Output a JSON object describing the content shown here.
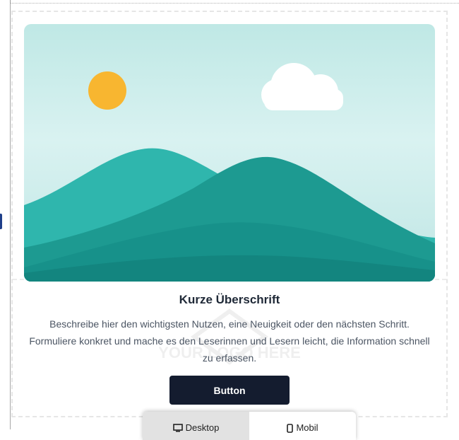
{
  "card": {
    "heading": "Kurze Überschrift",
    "description": "Beschreibe hier den wichtigsten Nutzen, eine Neuigkeit oder den nächsten Schritt. Formuliere konkret und mache es den Leserinnen und Lesern leicht, die Information schnell zu erfassen.",
    "button_label": "Button"
  },
  "view_toggle": {
    "options": [
      {
        "label": "Desktop",
        "icon": "monitor-icon",
        "active": true
      },
      {
        "label": "Mobil",
        "icon": "phone-icon",
        "active": false
      }
    ]
  },
  "colors": {
    "button_bg": "#141c2f",
    "sky_top": "#b9e6e3",
    "sun": "#f8b630",
    "hill_back": "#2db5ad",
    "hill_front": "#1a948b"
  },
  "watermark": {
    "text": "YOUR LOGO HERE"
  }
}
